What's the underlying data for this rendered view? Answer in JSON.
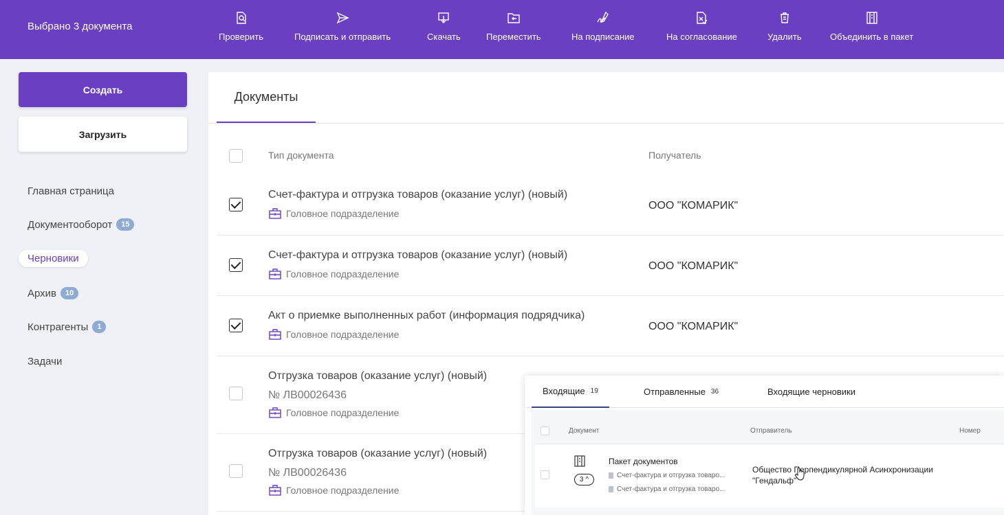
{
  "topbar": {
    "selection": "Выбрано 3 документа",
    "actions": [
      {
        "label": "Проверить",
        "icon": "check-doc-icon"
      },
      {
        "label": "Подписать и отправить",
        "icon": "send-icon"
      },
      {
        "label": "Скачать",
        "icon": "download-icon"
      },
      {
        "label": "Переместить",
        "icon": "move-folder-icon"
      },
      {
        "label": "На подписание",
        "icon": "signature-icon"
      },
      {
        "label": "На согласование",
        "icon": "approve-doc-icon"
      },
      {
        "label": "Удалить",
        "icon": "trash-icon"
      },
      {
        "label": "Объединить в пакет",
        "icon": "package-icon"
      }
    ]
  },
  "sidebar": {
    "create_label": "Создать",
    "upload_label": "Загрузить",
    "items": [
      {
        "label": "Главная страница",
        "badge": ""
      },
      {
        "label": "Документооборот",
        "badge": "15"
      },
      {
        "label": "Черновики",
        "badge": ""
      },
      {
        "label": "Архив",
        "badge": "10"
      },
      {
        "label": "Контрагенты",
        "badge": "1"
      },
      {
        "label": "Задачи",
        "badge": ""
      }
    ]
  },
  "main": {
    "tab": "Документы",
    "columns": {
      "type": "Тип документа",
      "recipient": "Получатель"
    },
    "rows": [
      {
        "title": "Счет-фактура и отгрузка товаров (оказание услуг) (новый)",
        "number": "",
        "department": "Головное подразделение",
        "recipient": "ООО \"КОМАРИК\"",
        "checked": true
      },
      {
        "title": "Счет-фактура и отгрузка товаров (оказание услуг) (новый)",
        "number": "",
        "department": "Головное подразделение",
        "recipient": "ООО \"КОМАРИК\"",
        "checked": true
      },
      {
        "title": "Акт о приемке выполненных работ (информация подрядчика)",
        "number": "",
        "department": "Головное подразделение",
        "recipient": "ООО \"КОМАРИК\"",
        "checked": true
      },
      {
        "title": "Отгрузка товаров (оказание услуг) (новый)",
        "number": "№ ЛВ00026436",
        "department": "Головное подразделение",
        "recipient": "",
        "checked": false
      },
      {
        "title": "Отгрузка товаров (оказание услуг) (новый)",
        "number": "№ ЛВ00026436",
        "department": "Головное подразделение",
        "recipient": "",
        "checked": false
      }
    ]
  },
  "overlay": {
    "tabs": [
      {
        "label": "Входящие",
        "count": "19"
      },
      {
        "label": "Отправленные",
        "count": "36"
      },
      {
        "label": "Входящие черновики",
        "count": ""
      }
    ],
    "columns": {
      "document": "Документ",
      "sender": "Отправитель",
      "number": "Номер"
    },
    "row": {
      "title": "Пакет документов",
      "items": [
        "Счет-фактура и отгрузка товаро...",
        "Счет-фактура и отгрузка товаро..."
      ],
      "count": "3",
      "sender_line1": "Общество Перпендикулярной Асинхронизации",
      "sender_line2": "\"Гендальф\""
    }
  }
}
